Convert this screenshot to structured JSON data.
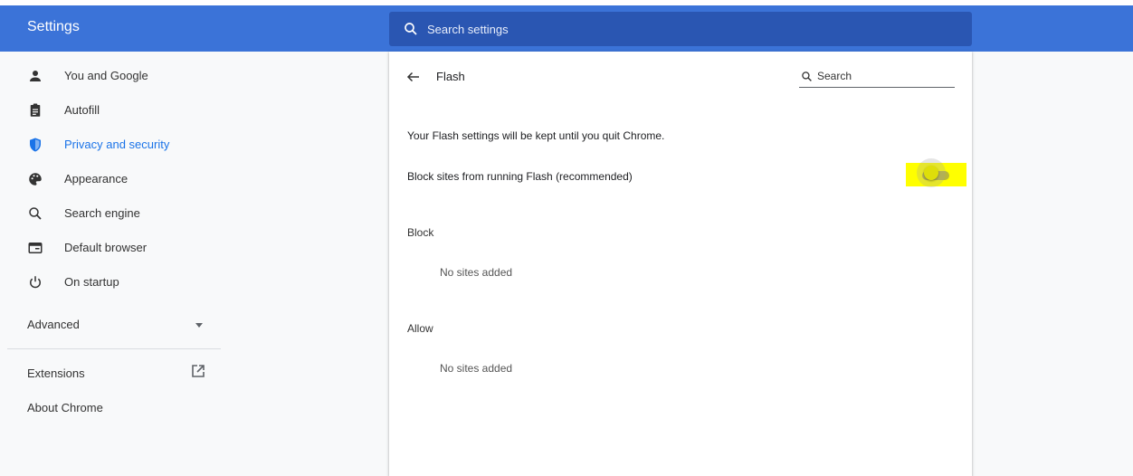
{
  "header": {
    "title": "Settings",
    "search_placeholder": "Search settings"
  },
  "sidebar": {
    "items": [
      {
        "label": "You and Google",
        "icon": "person-icon"
      },
      {
        "label": "Autofill",
        "icon": "clipboard-icon"
      },
      {
        "label": "Privacy and security",
        "icon": "shield-icon",
        "active": true
      },
      {
        "label": "Appearance",
        "icon": "palette-icon"
      },
      {
        "label": "Search engine",
        "icon": "search-icon"
      },
      {
        "label": "Default browser",
        "icon": "browser-window-icon"
      },
      {
        "label": "On startup",
        "icon": "power-icon"
      }
    ],
    "advanced_label": "Advanced",
    "extensions_label": "Extensions",
    "about_label": "About Chrome"
  },
  "main": {
    "title": "Flash",
    "search_placeholder": "Search",
    "info_text": "Your Flash settings will be kept until you quit Chrome.",
    "block_toggle_label": "Block sites from running Flash (recommended)",
    "block_toggle_on": false,
    "block_heading": "Block",
    "block_empty": "No sites added",
    "allow_heading": "Allow",
    "allow_empty": "No sites added"
  },
  "colors": {
    "header": "#3b73d8",
    "header_search": "#2a56b2",
    "active_blue": "#1a73e8",
    "highlight": "#ffff00"
  }
}
